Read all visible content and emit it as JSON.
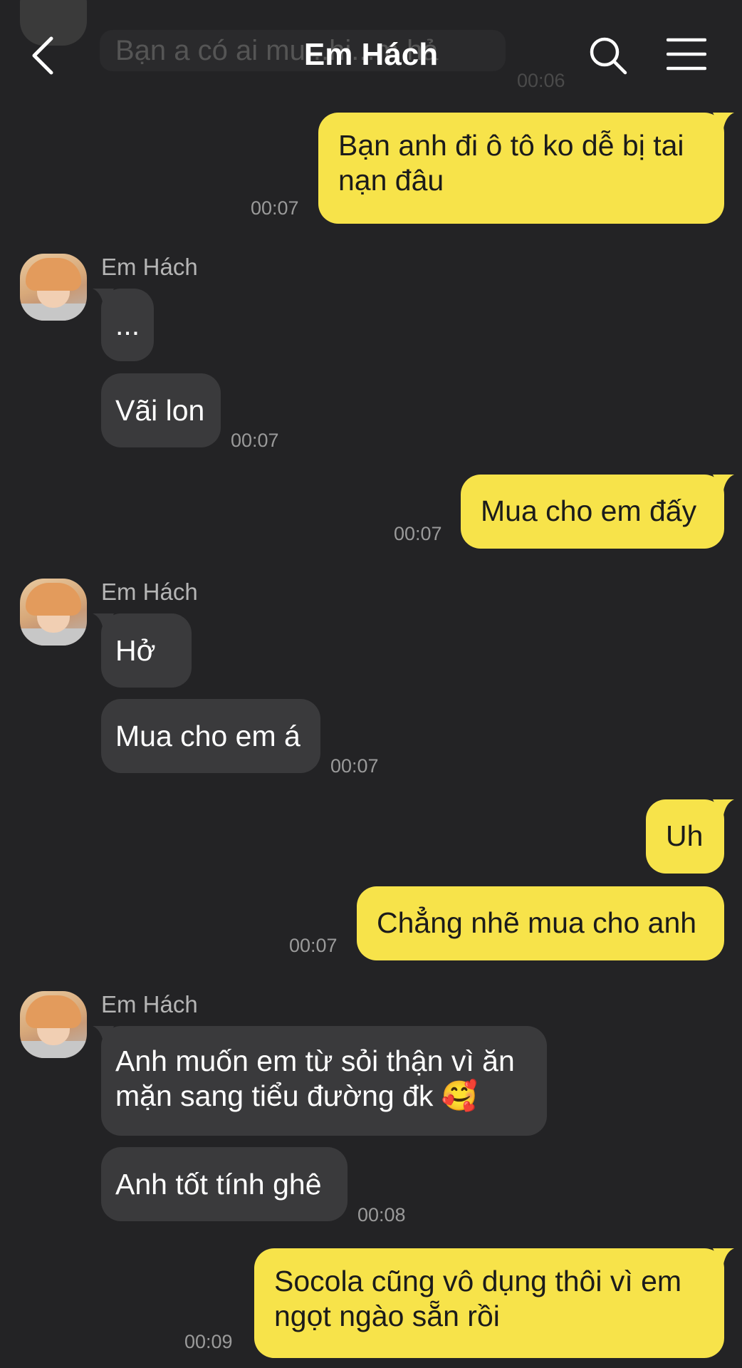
{
  "header": {
    "title": "Em Hách"
  },
  "ghost_message": {
    "text": "Bạn a có ai mu...hi...m hả",
    "time": "00:06"
  },
  "messages": [
    {
      "from": "me",
      "lines": "Bạn anh đi ô tô ko dễ bị tai nạn đâu",
      "time": "00:07"
    },
    {
      "from": "them",
      "sender": "Em Hách",
      "text": "..."
    },
    {
      "from": "them",
      "text": "Vãi lon",
      "time": "00:07"
    },
    {
      "from": "me",
      "lines": "Mua cho em đấy",
      "time": "00:07"
    },
    {
      "from": "them",
      "sender": "Em Hách",
      "text": "Hở ?"
    },
    {
      "from": "them",
      "text": "Mua cho em á",
      "time": "00:07"
    },
    {
      "from": "me",
      "lines": "Uh"
    },
    {
      "from": "me",
      "lines": "Chẳng nhẽ mua cho anh",
      "time": "00:07"
    },
    {
      "from": "them",
      "sender": "Em Hách",
      "text": "Anh muốn em từ sỏi thận vì ăn mặn sang tiểu đường đk 🥰"
    },
    {
      "from": "them",
      "text": "Anh tốt tính ghê",
      "time": "00:08"
    },
    {
      "from": "me",
      "lines": "Socola cũng vô dụng thôi vì em ngọt ngào sẵn rồi",
      "time": "00:09"
    }
  ],
  "colors": {
    "background": "#232325",
    "my_bubble": "#f7e34a",
    "their_bubble": "#3a3a3c",
    "timestamp": "#9a9a9a"
  }
}
